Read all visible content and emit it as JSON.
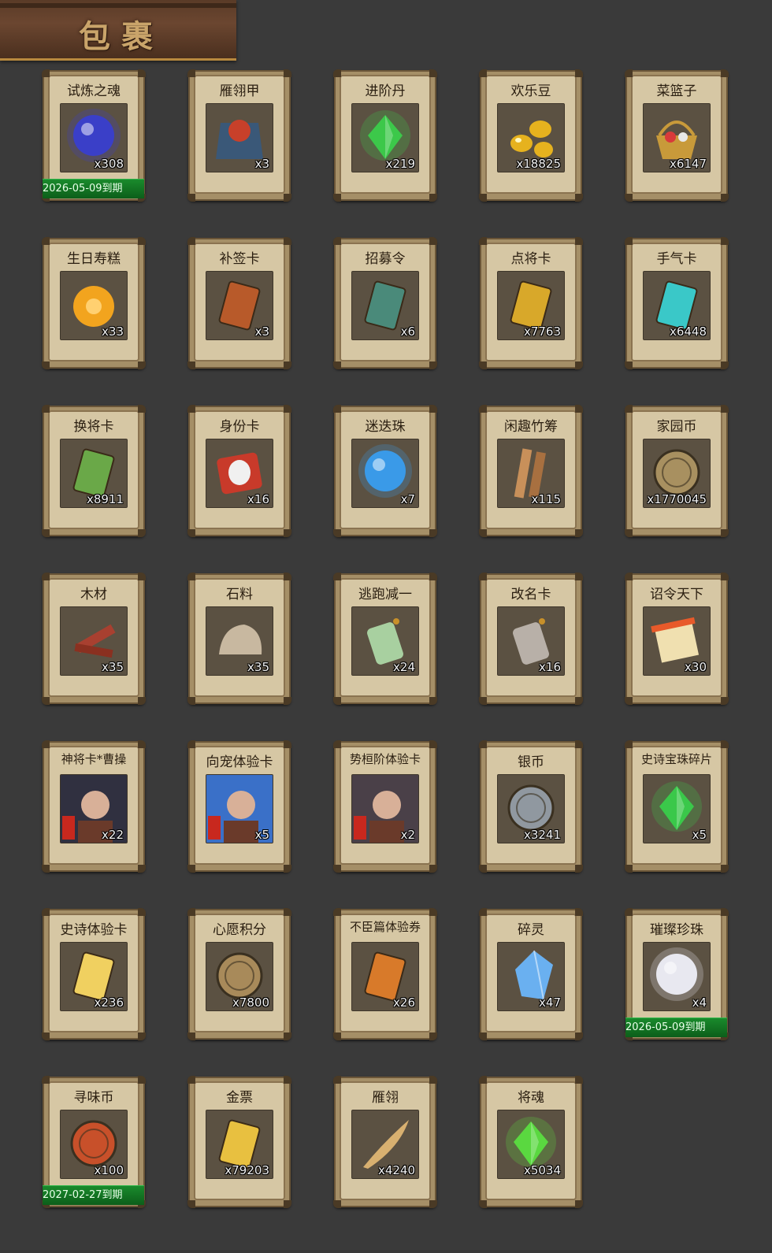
{
  "header": {
    "title": "包裹"
  },
  "items": [
    {
      "name": "试炼之魂",
      "qty": "x308",
      "expiry": "2026-05-09到期",
      "icon": "dragon-orb-icon",
      "color": "#3a3fc8"
    },
    {
      "name": "雁翎甲",
      "qty": "x3",
      "expiry": "",
      "icon": "armor-icon",
      "color": "#c8402a"
    },
    {
      "name": "进阶丹",
      "qty": "x219",
      "expiry": "",
      "icon": "green-pill-icon",
      "color": "#3cc84a"
    },
    {
      "name": "欢乐豆",
      "qty": "x18825",
      "expiry": "",
      "icon": "golden-beans-icon",
      "color": "#e6b21e"
    },
    {
      "name": "菜篮子",
      "qty": "x6147",
      "expiry": "",
      "icon": "basket-icon",
      "color": "#c89a3a"
    },
    {
      "name": "生日寿糕",
      "qty": "x33",
      "expiry": "",
      "icon": "cake-icon",
      "color": "#f2a41e"
    },
    {
      "name": "补签卡",
      "qty": "x3",
      "expiry": "",
      "icon": "sign-card-icon",
      "color": "#b85a2a"
    },
    {
      "name": "招募令",
      "qty": "x6",
      "expiry": "",
      "icon": "recruit-token-icon",
      "color": "#4a8a7a"
    },
    {
      "name": "点将卡",
      "qty": "x7763",
      "expiry": "",
      "icon": "general-card-icon",
      "color": "#d8a82a"
    },
    {
      "name": "手气卡",
      "qty": "x6448",
      "expiry": "",
      "icon": "luck-card-icon",
      "color": "#3ac8c8"
    },
    {
      "name": "换将卡",
      "qty": "x8911",
      "expiry": "",
      "icon": "swap-card-icon",
      "color": "#6aa848"
    },
    {
      "name": "身份卡",
      "qty": "x16",
      "expiry": "",
      "icon": "identity-mask-icon",
      "color": "#c83a2a"
    },
    {
      "name": "迷迭珠",
      "qty": "x7",
      "expiry": "",
      "icon": "blue-orb-icon",
      "color": "#3a9ae8"
    },
    {
      "name": "闲趣竹筹",
      "qty": "x115",
      "expiry": "",
      "icon": "bamboo-token-icon",
      "color": "#c8905a"
    },
    {
      "name": "家园币",
      "qty": "x1770045",
      "expiry": "",
      "icon": "home-coin-icon",
      "color": "#a89060"
    },
    {
      "name": "木材",
      "qty": "x35",
      "expiry": "",
      "icon": "wood-icon",
      "color": "#a84030"
    },
    {
      "name": "石料",
      "qty": "x35",
      "expiry": "",
      "icon": "stone-icon",
      "color": "#c8b8a0"
    },
    {
      "name": "逃跑减一",
      "qty": "x24",
      "expiry": "",
      "icon": "jade-tag-icon",
      "color": "#a8d0a0"
    },
    {
      "name": "改名卡",
      "qty": "x16",
      "expiry": "",
      "icon": "rename-tag-icon",
      "color": "#b8b0a8"
    },
    {
      "name": "诏令天下",
      "qty": "x30",
      "expiry": "",
      "icon": "edict-scroll-icon",
      "color": "#e85a2a"
    },
    {
      "name": "神将卡*曹操",
      "qty": "x22",
      "expiry": "",
      "icon": "caocao-portrait-icon",
      "color": "#303040"
    },
    {
      "name": "向宠体验卡",
      "qty": "x5",
      "expiry": "",
      "icon": "xiangchong-portrait-icon",
      "color": "#3a70c8"
    },
    {
      "name": "势桓阶体验卡",
      "qty": "x2",
      "expiry": "",
      "icon": "huanjie-portrait-icon",
      "color": "#4a4048"
    },
    {
      "name": "银币",
      "qty": "x3241",
      "expiry": "",
      "icon": "silver-coin-icon",
      "color": "#9098a0"
    },
    {
      "name": "史诗宝珠碎片",
      "qty": "x5",
      "expiry": "",
      "icon": "green-shard-icon",
      "color": "#3ac84a"
    },
    {
      "name": "史诗体验卡",
      "qty": "x236",
      "expiry": "",
      "icon": "gold-card-icon",
      "color": "#f0d060"
    },
    {
      "name": "心愿积分",
      "qty": "x7800",
      "expiry": "",
      "icon": "heart-coin-icon",
      "color": "#a88a5a"
    },
    {
      "name": "不臣篇体验券",
      "qty": "x26",
      "expiry": "",
      "icon": "ticket-icon",
      "color": "#d87a2a"
    },
    {
      "name": "碎灵",
      "qty": "x47",
      "expiry": "",
      "icon": "crystal-icon",
      "color": "#6ab0f0"
    },
    {
      "name": "璀璨珍珠",
      "qty": "x4",
      "expiry": "2026-05-09到期",
      "icon": "pearl-icon",
      "color": "#e8e8f0"
    },
    {
      "name": "寻味币",
      "qty": "x100",
      "expiry": "2027-02-27到期",
      "icon": "taste-coin-icon",
      "color": "#c8502a"
    },
    {
      "name": "金票",
      "qty": "x79203",
      "expiry": "",
      "icon": "gold-ticket-icon",
      "color": "#e8c040"
    },
    {
      "name": "雁翎",
      "qty": "x4240",
      "expiry": "",
      "icon": "feather-icon",
      "color": "#d8b070"
    },
    {
      "name": "将魂",
      "qty": "x5034",
      "expiry": "",
      "icon": "green-soul-icon",
      "color": "#5ad840"
    }
  ]
}
